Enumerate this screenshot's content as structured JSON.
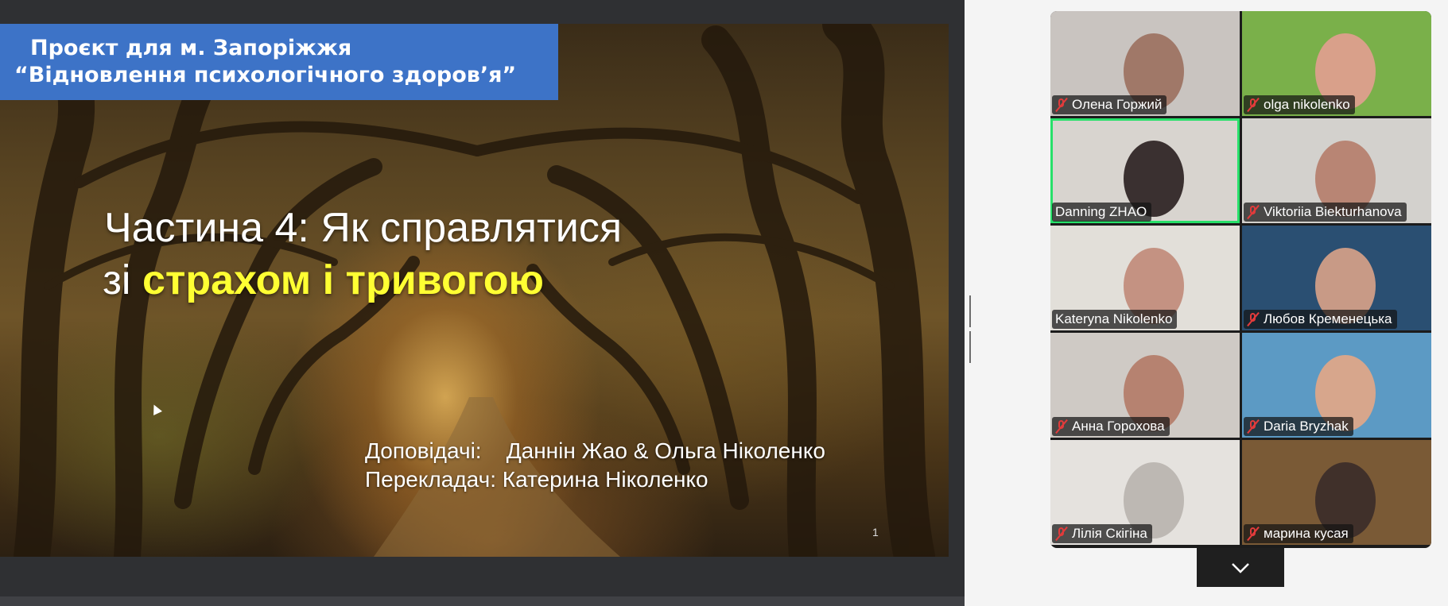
{
  "slide": {
    "banner_line1": "Проєкт для м. Запоріжжя",
    "banner_line2": "“Відновлення психологічного здоров’я”",
    "headline_line1": "Частина 4: Як справлятися",
    "headline_line2_prefix": "зі ",
    "headline_line2_highlight": "страхом і тривогою",
    "speakers_label": "Доповідачі:",
    "speakers": "Даннін Жао & Ольга Ніколенко",
    "translator_label": "Перекладач:",
    "translator": "Катерина Ніколенко",
    "page_number": "1"
  },
  "participants": [
    {
      "name": "Олена Горжий",
      "muted": true,
      "bg": "#c9c4c0",
      "face": "#a07868",
      "active": false
    },
    {
      "name": "olga nikolenko",
      "muted": true,
      "bg": "#7ab04a",
      "face": "#d9a08a",
      "active": false
    },
    {
      "name": "Danning ZHAO",
      "muted": false,
      "bg": "#d8d4cf",
      "face": "#3a3030",
      "active": true
    },
    {
      "name": "Viktoriia Biekturhanova",
      "muted": true,
      "bg": "#d3d1cd",
      "face": "#b88574",
      "active": false
    },
    {
      "name": "Kateryna Nikolenko",
      "muted": false,
      "bg": "#e2dfd9",
      "face": "#c49282",
      "active": false
    },
    {
      "name": "Любов Кременецька",
      "muted": true,
      "bg": "#2a4f72",
      "face": "#c89a86",
      "active": false
    },
    {
      "name": "Анна Горохова",
      "muted": true,
      "bg": "#cfcac5",
      "face": "#b68270",
      "active": false
    },
    {
      "name": "Daria Bryzhak",
      "muted": true,
      "bg": "#5c9ac4",
      "face": "#d7a68c",
      "active": false
    },
    {
      "name": "Лілія Скігіна",
      "muted": true,
      "bg": "#e5e2de",
      "face": "#bdb8b3",
      "active": false
    },
    {
      "name": "марина кусая",
      "muted": true,
      "bg": "#7a5a36",
      "face": "#40302a",
      "active": false
    }
  ]
}
